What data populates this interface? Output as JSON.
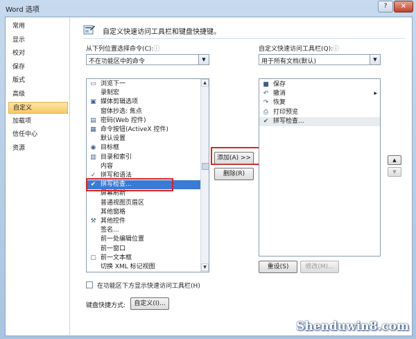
{
  "window": {
    "title": "Word 选项",
    "help": "?",
    "close": "✕"
  },
  "nav": {
    "items": [
      {
        "label": "常用",
        "selected": false
      },
      {
        "label": "显示",
        "selected": false
      },
      {
        "label": "校对",
        "selected": false
      },
      {
        "label": "保存",
        "selected": false
      },
      {
        "label": "版式",
        "selected": false
      },
      {
        "label": "高级",
        "selected": false
      },
      {
        "label": "自定义",
        "selected": true
      },
      {
        "label": "加载项",
        "selected": false
      },
      {
        "label": "信任中心",
        "selected": false
      },
      {
        "label": "资源",
        "selected": false
      }
    ]
  },
  "header": {
    "text": "自定义快速访问工具栏和键盘快捷键。"
  },
  "left_panel": {
    "choose_label": "从下列位置选择命令(C):",
    "info_icon": "ⓘ",
    "choose_value": "不在功能区中的命令",
    "list": [
      {
        "icon": "folder-icon",
        "label": "浏览下一"
      },
      {
        "icon": "",
        "label": "录制宏"
      },
      {
        "icon": "clip-icon",
        "label": "媒体剪辑选项"
      },
      {
        "icon": "",
        "label": "窗体抄选: 焦点"
      },
      {
        "icon": "password-icon",
        "label": "密码(Web 控件)"
      },
      {
        "icon": "activex-button-icon",
        "label": "命令按钮(ActiveX 控件)"
      },
      {
        "icon": "",
        "label": "默认设置"
      },
      {
        "icon": "target-icon",
        "label": "目标框"
      },
      {
        "icon": "index-icon",
        "label": "目录和索引"
      },
      {
        "icon": "",
        "label": "内容"
      },
      {
        "icon": "spelling-icon",
        "label": "拼写和语法"
      },
      {
        "icon": "spellcheck-icon",
        "label": "拼写检查..."
      },
      {
        "icon": "",
        "label": "屏幕刷新"
      },
      {
        "icon": "",
        "label": "普通视图页眉区"
      },
      {
        "icon": "",
        "label": "其他窗格"
      },
      {
        "icon": "controls-icon",
        "label": "其他控件"
      },
      {
        "icon": "",
        "label": "签名..."
      },
      {
        "icon": "",
        "label": "前一处编辑位置"
      },
      {
        "icon": "",
        "label": "前一窗口"
      },
      {
        "icon": "textbox-icon",
        "label": "前一文本框"
      },
      {
        "icon": "",
        "label": "切换 XML 标记视图"
      }
    ],
    "selected_index": 11,
    "show_below_label": "在功能区下方显示快速访问工具栏(H)",
    "shortcut_label": "键盘快捷方式:",
    "customize_button": "自定义(I)..."
  },
  "middle": {
    "add_button": "添加(A) >>",
    "remove_button": "删除(R)"
  },
  "right_panel": {
    "toolbar_label": "自定义快速访问工具栏(Q):",
    "info_icon": "ⓘ",
    "toolbar_value": "用于所有文档(默认)",
    "list": [
      {
        "icon": "save-icon",
        "label": "保存"
      },
      {
        "icon": "undo-icon",
        "label": "撤消",
        "has_submenu": true
      },
      {
        "icon": "redo-icon",
        "label": "恢复"
      },
      {
        "icon": "print-preview-icon",
        "label": "打印预览"
      },
      {
        "icon": "spellcheck-icon",
        "label": "拼写检查..."
      }
    ],
    "highlighted_index": 4,
    "reset_button": "重设(S)",
    "modify_button": "修改(M)...",
    "move_up": "▲",
    "move_down": "▼"
  },
  "watermark": "Shenduwin8.com",
  "colors": {
    "selection": "#3a7bd5",
    "nav_selected": "#f8c866",
    "highlight_box": "#e02020"
  }
}
